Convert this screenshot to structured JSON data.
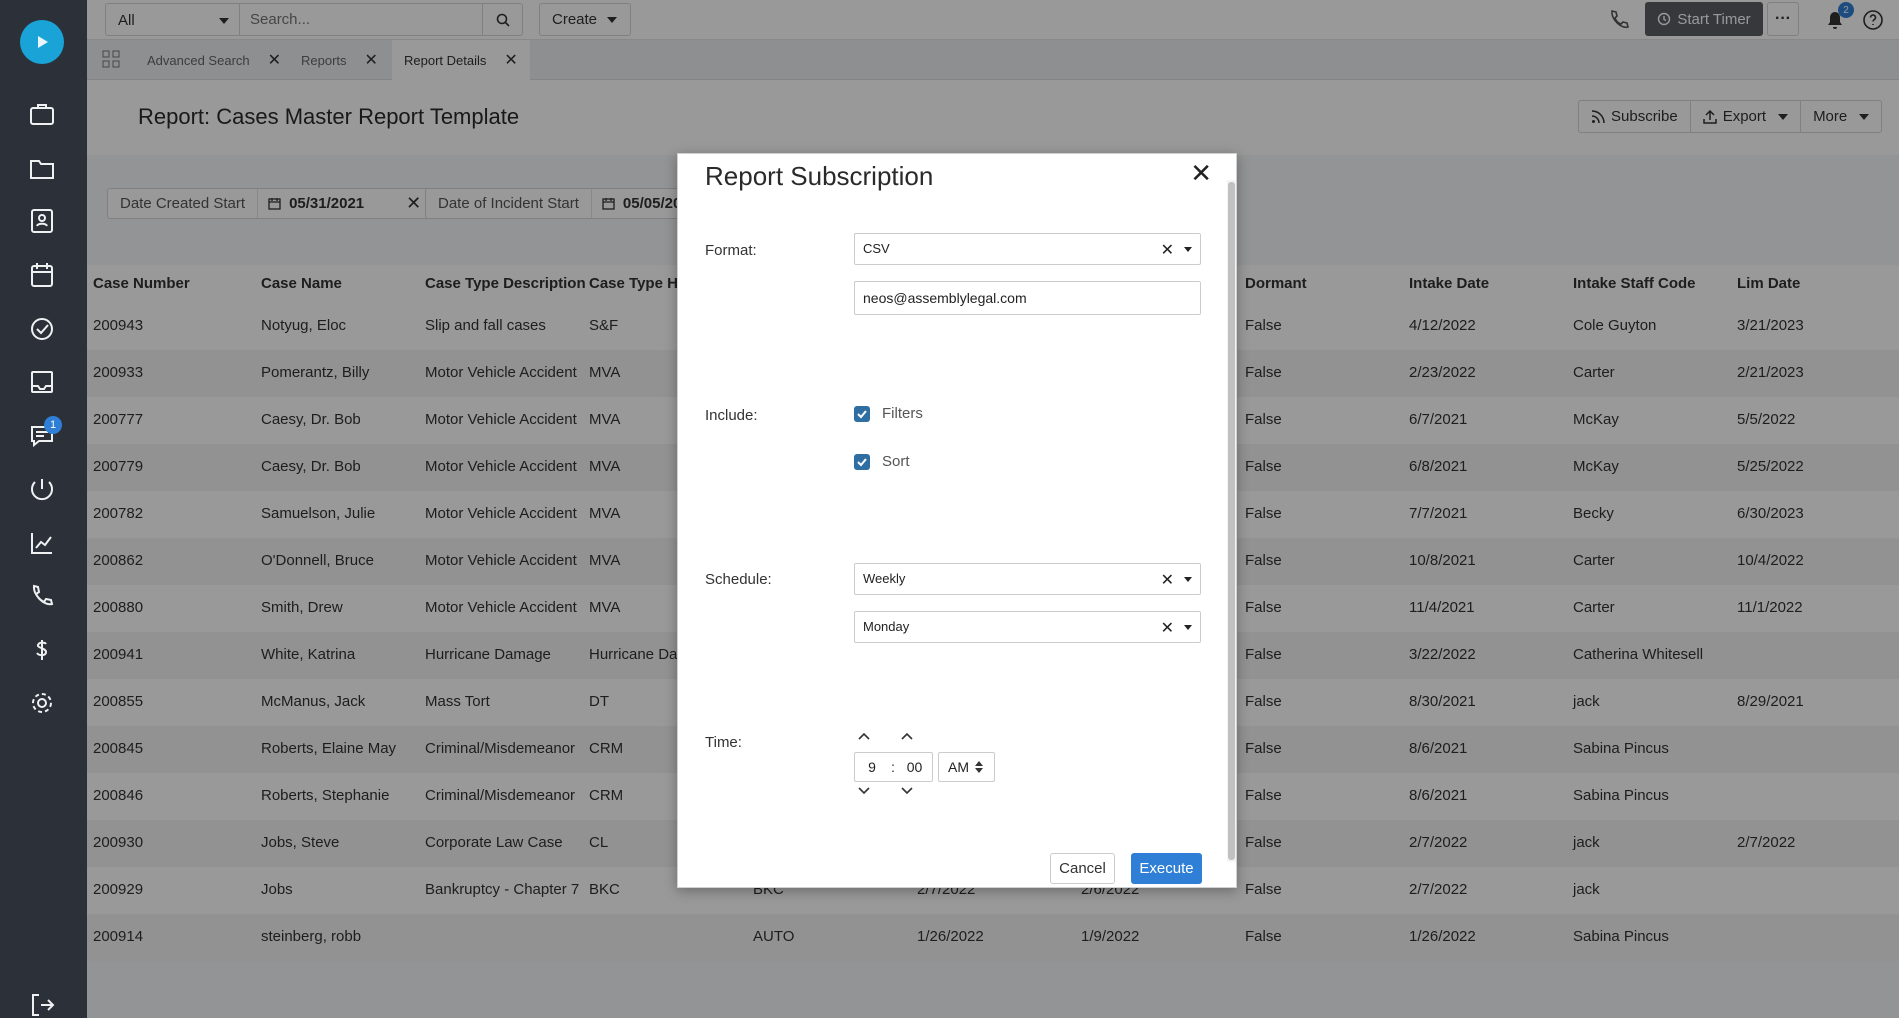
{
  "topbar": {
    "scope": "All",
    "search_placeholder": "Search...",
    "create_label": "Create",
    "start_timer_label": "Start Timer",
    "more_label": "···",
    "notification_count": "2"
  },
  "sidebar": {
    "message_badge": "1",
    "items": [
      "cases-icon",
      "folder-icon",
      "contacts-icon",
      "calendar-icon",
      "tasks-icon",
      "inbox-icon",
      "messages-icon",
      "intake-icon",
      "reports-icon",
      "calls-icon",
      "billing-icon",
      "settings-icon",
      "logout-icon"
    ]
  },
  "tabs": [
    {
      "label": "Advanced Search"
    },
    {
      "label": "Reports"
    },
    {
      "label": "Report Details"
    }
  ],
  "header": {
    "title": "Report: Cases Master Report Template",
    "subscribe_label": "Subscribe",
    "export_label": "Export",
    "more_label": "More"
  },
  "filters": [
    {
      "label": "Date Created Start",
      "value": "05/31/2021"
    },
    {
      "label": "Date of Incident Start",
      "value": "05/05/20"
    }
  ],
  "table": {
    "columns": [
      "Case Number",
      "Case Name",
      "Case Type Description",
      "Case Type He",
      "Dormant",
      "Intake Date",
      "Intake Staff Code",
      "Lim Date"
    ],
    "rows": [
      [
        "200943",
        "Notyug, Eloc",
        "Slip and fall cases",
        "S&F",
        "",
        "",
        "",
        "False",
        "4/12/2022",
        "Cole Guyton",
        "3/21/2023"
      ],
      [
        "200933",
        "Pomerantz, Billy",
        "Motor Vehicle Accident",
        "MVA",
        "",
        "",
        "",
        "False",
        "2/23/2022",
        "Carter",
        "2/21/2023"
      ],
      [
        "200777",
        "Caesy, Dr. Bob",
        "Motor Vehicle Accident",
        "MVA",
        "",
        "",
        "",
        "False",
        "6/7/2021",
        "McKay",
        "5/5/2022"
      ],
      [
        "200779",
        "Caesy, Dr. Bob",
        "Motor Vehicle Accident",
        "MVA",
        "",
        "",
        "",
        "False",
        "6/8/2021",
        "McKay",
        "5/25/2022"
      ],
      [
        "200782",
        "Samuelson, Julie",
        "Motor Vehicle Accident",
        "MVA",
        "",
        "",
        "",
        "False",
        "7/7/2021",
        "Becky",
        "6/30/2023"
      ],
      [
        "200862",
        "O'Donnell, Bruce",
        "Motor Vehicle Accident",
        "MVA",
        "",
        "",
        "",
        "False",
        "10/8/2021",
        "Carter",
        "10/4/2022"
      ],
      [
        "200880",
        "Smith, Drew",
        "Motor Vehicle Accident",
        "MVA",
        "",
        "",
        "",
        "False",
        "11/4/2021",
        "Carter",
        "11/1/2022"
      ],
      [
        "200941",
        "White, Katrina",
        "Hurricane Damage",
        "Hurricane Da",
        "",
        "",
        "",
        "False",
        "3/22/2022",
        "Catherina Whitesell",
        ""
      ],
      [
        "200855",
        "McManus, Jack",
        "Mass Tort",
        "DT",
        "",
        "",
        "",
        "False",
        "8/30/2021",
        "jack",
        "8/29/2021"
      ],
      [
        "200845",
        "Roberts, Elaine May",
        "Criminal/Misdemeanor",
        "CRM",
        "",
        "",
        "",
        "False",
        "8/6/2021",
        "Sabina Pincus",
        ""
      ],
      [
        "200846",
        "Roberts, Stephanie",
        "Criminal/Misdemeanor",
        "CRM",
        "",
        "",
        "",
        "False",
        "8/6/2021",
        "Sabina Pincus",
        ""
      ],
      [
        "200930",
        "Jobs, Steve",
        "Corporate Law Case",
        "CL",
        "",
        "",
        "",
        "False",
        "2/7/2022",
        "jack",
        "2/7/2022"
      ],
      [
        "200929",
        "Jobs",
        "Bankruptcy - Chapter 7",
        "BKC",
        "BKC",
        "2/7/2022",
        "2/6/2022",
        "False",
        "2/7/2022",
        "jack",
        ""
      ],
      [
        "200914",
        "steinberg, robb",
        "",
        "",
        "AUTO",
        "1/26/2022",
        "1/9/2022",
        "False",
        "1/26/2022",
        "Sabina Pincus",
        ""
      ]
    ]
  },
  "modal": {
    "title": "Report Subscription",
    "format_label": "Format:",
    "format_value": "CSV",
    "email_value": "neos@assemblylegal.com",
    "include_label": "Include:",
    "filters_label": "Filters",
    "sort_label": "Sort",
    "schedule_label": "Schedule:",
    "schedule_value": "Weekly",
    "day_value": "Monday",
    "time_label": "Time:",
    "hour": "9",
    "colon": ":",
    "minute": "00",
    "ampm": "AM",
    "cancel_label": "Cancel",
    "execute_label": "Execute"
  },
  "colors": {
    "sidebar_bg": "#2b3039",
    "accent": "#2f7fd6",
    "checkbox": "#2f6ea3"
  }
}
